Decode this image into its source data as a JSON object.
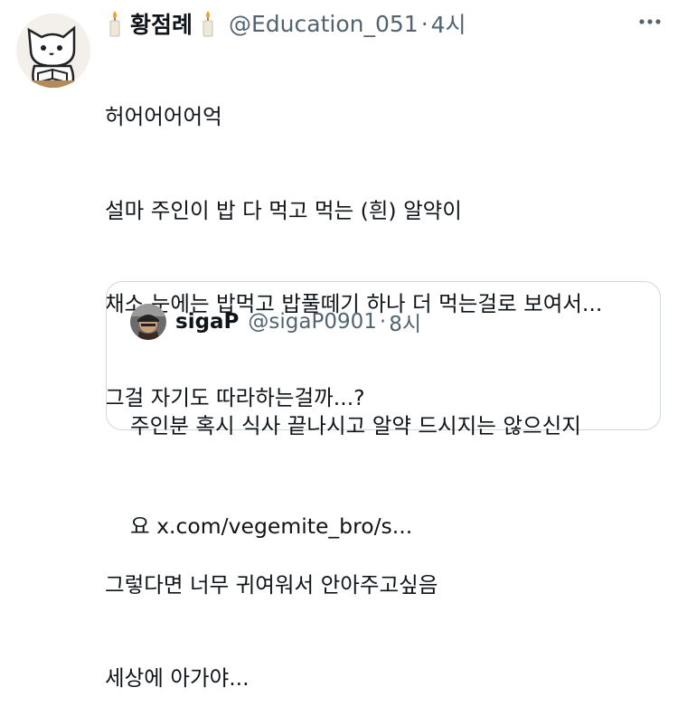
{
  "author": {
    "name": "황점례",
    "handle": "@Education_051",
    "separator": "·",
    "time": "4시",
    "avatar_icon": "cat-reading-book-avatar",
    "emoji_icon": "candle-emoji"
  },
  "tweet": {
    "lines": [
      "허어어어어억",
      "설마 주인이 밥 다 먹고 먹는 (흰) 알약이",
      "채소 눈에는 밥먹고 밥풀떼기 하나 더 먹는걸로 보여서...",
      "그걸 자기도 따라하는걸까...?",
      "",
      "그렇다면 너무 귀여워서 안아주고싶음",
      "세상에 아가야..."
    ]
  },
  "quoted": {
    "name": "sigaP",
    "handle": "@sigaP0901",
    "separator": "·",
    "time": "8시",
    "avatar_icon": "person-with-cap-avatar",
    "lines": [
      "주인분 혹시 식사 끝나시고 알약 드시지는 않으신지",
      "요 x.com/vegemite_bro/s..."
    ]
  },
  "more_icon": "more-options-icon"
}
